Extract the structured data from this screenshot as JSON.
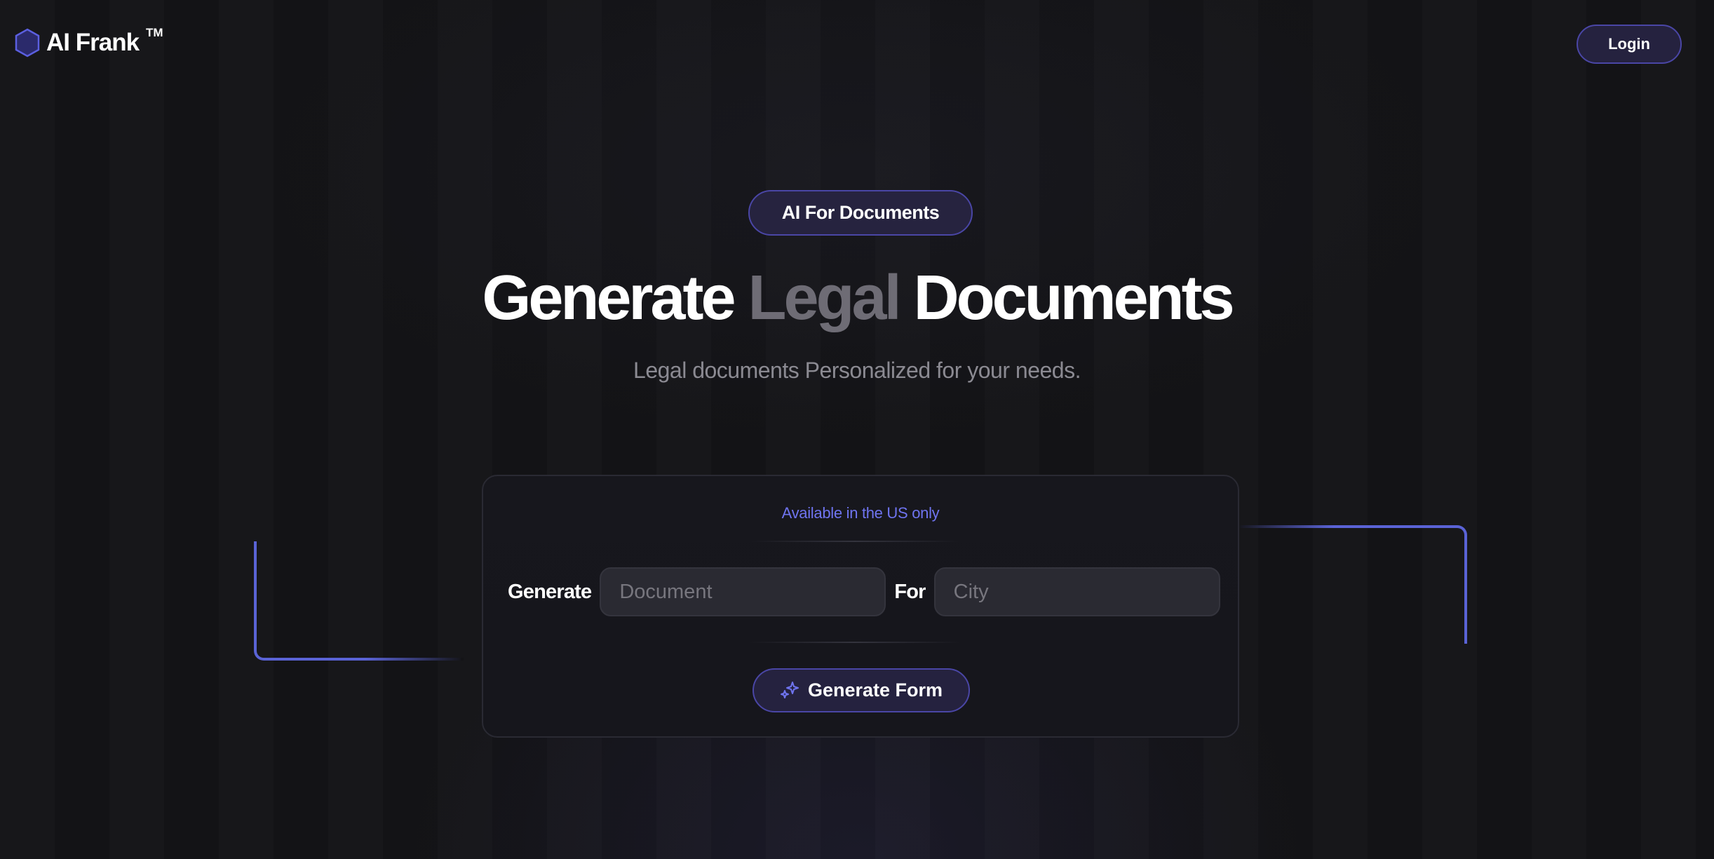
{
  "header": {
    "logo_text": "AI Frank",
    "logo_tm": "TM",
    "login_label": "Login"
  },
  "hero": {
    "pill_label": "AI For Documents",
    "headline_start": "Generate ",
    "headline_middle": "Legal",
    "headline_end": " Documents",
    "subtitle": "Legal documents Personalized for your needs."
  },
  "form": {
    "availability": "Available in the US only",
    "generate_label": "Generate",
    "document_placeholder": "Document",
    "for_label": "For",
    "city_placeholder": "City",
    "submit_label": "Generate Form"
  },
  "colors": {
    "accent": "#6f74f0",
    "button_bg": "#25223f",
    "button_border": "#4a46a6",
    "background": "#141417"
  },
  "icons": {
    "logo": "hexagon-icon",
    "submit": "sparkles-icon"
  }
}
